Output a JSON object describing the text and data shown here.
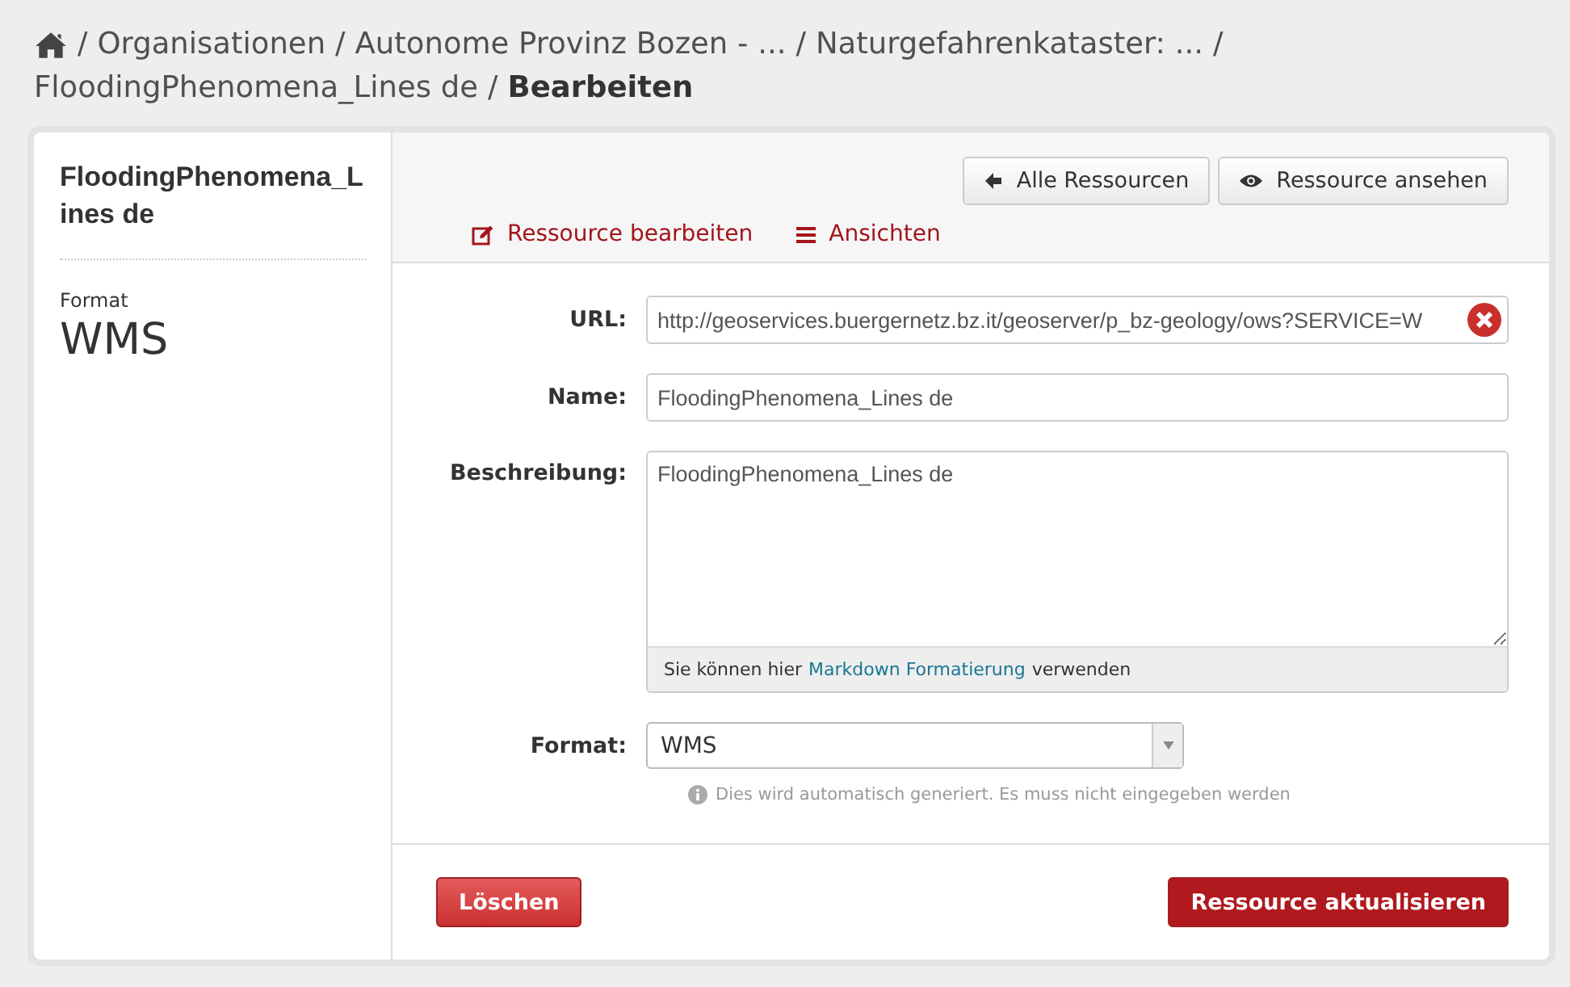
{
  "breadcrumb": [
    {
      "separator": "/",
      "label": "Organisationen",
      "current": false
    },
    {
      "separator": "/",
      "label": "Autonome Provinz Bozen - ...",
      "current": false
    },
    {
      "separator": "/",
      "label": "Naturgefahrenkataster: ...",
      "current": false
    },
    {
      "separator": "/",
      "label": "FloodingPhenomena_Lines de",
      "current": false
    },
    {
      "separator": "/",
      "label": "Bearbeiten",
      "current": true
    }
  ],
  "sidebar": {
    "title": "FloodingPhenomena_Lines de",
    "format_label": "Format",
    "format_value": "WMS"
  },
  "actions": [
    "Alle Ressourcen",
    "Ressource ansehen"
  ],
  "tabs": [
    "Ressource bearbeiten",
    "Ansichten"
  ],
  "form": {
    "url": {
      "label": "URL:",
      "value": "http://geoservices.buergernetz.bz.it/geoserver/p_bz-geology/ows?SERVICE=W"
    },
    "name": {
      "label": "Name:",
      "value": "FloodingPhenomena_Lines de"
    },
    "description": {
      "label": "Beschreibung:",
      "value": "FloodingPhenomena_Lines de",
      "hint_before": "Sie können hier",
      "hint_link": "Markdown Formatierung",
      "hint_after": "verwenden"
    },
    "format": {
      "label": "Format:",
      "value": "WMS",
      "info": "Dies wird automatisch generiert. Es muss nicht eingegeben werden"
    }
  },
  "buttons": {
    "delete": "Löschen",
    "submit": "Ressource aktualisieren"
  }
}
